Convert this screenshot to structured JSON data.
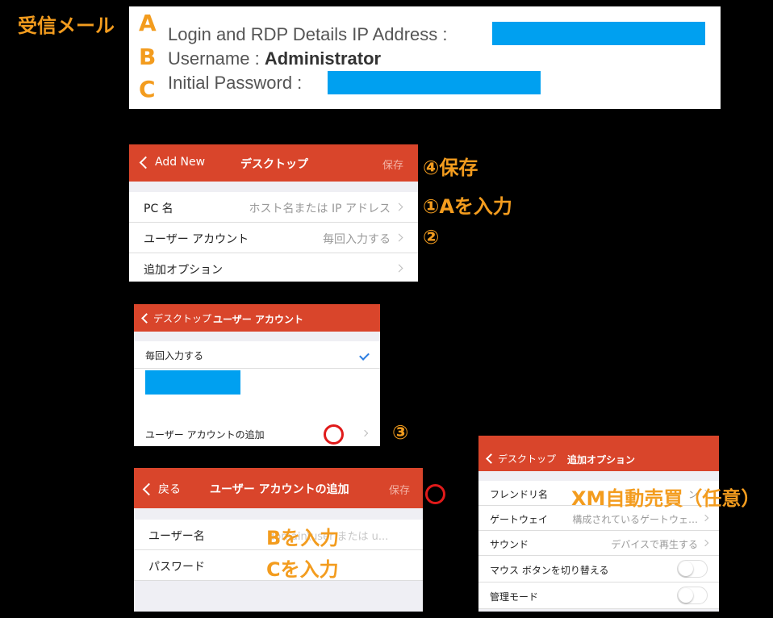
{
  "received_mail_label": "受信メール",
  "email": {
    "marker_a": "A",
    "marker_b": "B",
    "marker_c": "C",
    "line_a": "Login and RDP Details IP Address :",
    "line_b_prefix": "Username : ",
    "line_b_value": "Administrator",
    "line_c": "Initial Password :",
    "redaction_color": "#00a0f0"
  },
  "panel_desktop": {
    "back_label": "Add New",
    "title": "デスクトップ",
    "save_label": "保存",
    "rows": [
      {
        "label": "PC 名",
        "value": "ホスト名または IP アドレス"
      },
      {
        "label": "ユーザー アカウント",
        "value": "毎回入力する"
      },
      {
        "label": "追加オプション",
        "value": ""
      }
    ]
  },
  "panel_user_account": {
    "back_label": "デスクトップ",
    "title": "ユーザー アカウント",
    "rows": [
      {
        "label": "毎回入力する",
        "checked": true
      },
      {
        "label": "ユーザー アカウントの追加"
      }
    ]
  },
  "panel_add_account": {
    "back_label": "戻る",
    "title": "ユーザー アカウントの追加",
    "save_label": "保存",
    "rows": [
      {
        "label": "ユーザー名",
        "placeholder": "domain\\user または u..."
      },
      {
        "label": "パスワード"
      }
    ]
  },
  "panel_options": {
    "back_label": "デスクトップ",
    "title": "追加オプション",
    "rows": [
      {
        "label": "フレンドリ名",
        "value": "ン"
      },
      {
        "label": "ゲートウェイ",
        "value": "構成されているゲートウェ…"
      },
      {
        "label": "サウンド",
        "value": "デバイスで再生する"
      },
      {
        "label": "マウス ボタンを切り替える",
        "toggle": false
      },
      {
        "label": "管理モード",
        "toggle": false
      }
    ]
  },
  "annotations": {
    "step4_save": "④保存",
    "step1": "①Aを入力",
    "step2": "②",
    "step3": "③",
    "input_b": "Bを入力",
    "input_c": "Cを入力",
    "xm_note": "XM自動売買（任意）"
  },
  "colors": {
    "nav_bar": "#d9452b",
    "annotation_orange": "#f39c1e",
    "highlight_circle": "#e01a1a",
    "check_blue": "#2b7de1"
  }
}
